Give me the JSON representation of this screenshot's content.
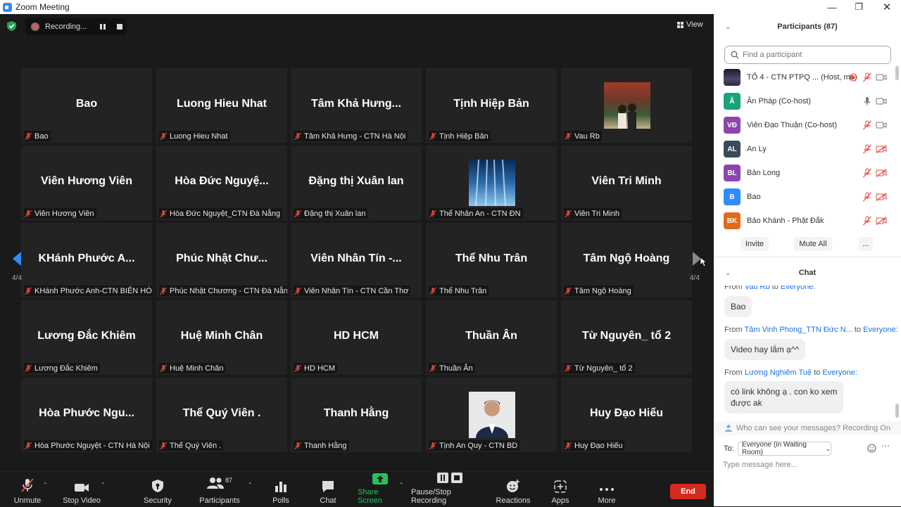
{
  "window": {
    "title": "Zoom Meeting"
  },
  "top": {
    "recording_label": "Recording...",
    "view_label": "View"
  },
  "pagination": {
    "left": "4/4",
    "right": "4/4"
  },
  "tiles": [
    {
      "big": "Bao",
      "label": "Bao",
      "muted": true
    },
    {
      "big": "Luong Hieu Nhat",
      "label": "Luong Hieu Nhat",
      "muted": true
    },
    {
      "big": "Tâm Khả Hưng...",
      "label": "Tâm Khả Hưng - CTN Hà Nội",
      "muted": true
    },
    {
      "big": "Tịnh Hiệp Bản",
      "label": "Tịnh Hiệp Bản",
      "muted": true
    },
    {
      "big": "",
      "label": "Vau Rb",
      "muted": true,
      "image": "photo-two-women"
    },
    {
      "big": "Viên Hương Viên",
      "label": "Viên Hương Viên",
      "muted": true
    },
    {
      "big": "Hòa Đức Nguyệ...",
      "label": "Hòa Đức Nguyệt_CTN Đà Nẵng",
      "muted": true
    },
    {
      "big": "Đặng thị Xuân lan",
      "label": "Đặng thị Xuân lan",
      "muted": true
    },
    {
      "big": "",
      "label": "Thể Nhân An - CTN ĐN",
      "muted": true,
      "image": "photo-blue-forest"
    },
    {
      "big": "Viên Tri Minh",
      "label": "Viên Tri Minh",
      "muted": true
    },
    {
      "big": "KHánh Phước A...",
      "label": "KHánh Phước Anh-CTN BIÊN HÒA",
      "muted": true
    },
    {
      "big": "Phúc Nhật Chư...",
      "label": "Phúc Nhật Chương - CTN Đà Nẵng",
      "muted": true
    },
    {
      "big": "Viên Nhân Tín -...",
      "label": "Viên Nhân Tín - CTN Cần Thơ",
      "muted": true
    },
    {
      "big": "Thể Nhu Trân",
      "label": "Thể Nhu Trân",
      "muted": true
    },
    {
      "big": "Tâm Ngộ Hoàng",
      "label": "Tâm Ngộ Hoàng",
      "muted": true
    },
    {
      "big": "Lương Đắc Khiêm",
      "label": "Lương Đắc Khiêm",
      "muted": true
    },
    {
      "big": "Huệ Minh Chân",
      "label": "Huệ Minh Chân",
      "muted": true
    },
    {
      "big": "HD HCM",
      "label": "HD HCM",
      "muted": true
    },
    {
      "big": "Thuần Ân",
      "label": "Thuần Ân",
      "muted": true
    },
    {
      "big": "Từ Nguyên_ tổ 2",
      "label": "Từ Nguyên_ tổ 2",
      "muted": true
    },
    {
      "big": "Hòa Phước Ngu...",
      "label": "Hòa Phước Nguyệt - CTN Hà Nội",
      "muted": true
    },
    {
      "big": "Thể Quý Viên .",
      "label": "Thể Quý Viên .",
      "muted": true
    },
    {
      "big": "Thanh Hằng",
      "label": "Thanh Hằng",
      "muted": true
    },
    {
      "big": "",
      "label": "Tịnh An Quy - CTN BD",
      "muted": true,
      "image": "photo-man-portrait"
    },
    {
      "big": "Huy Đạo Hiếu",
      "label": "Huy Đạo Hiếu",
      "muted": true
    }
  ],
  "toolbar": {
    "unmute": "Unmute",
    "stop_video": "Stop Video",
    "security": "Security",
    "participants": "Participants",
    "participants_count": "87",
    "polls": "Polls",
    "chat": "Chat",
    "share_screen": "Share Screen",
    "pause_stop_recording": "Pause/Stop Recording",
    "reactions": "Reactions",
    "apps": "Apps",
    "more": "More",
    "end": "End"
  },
  "participants_panel": {
    "title": "Participants (87)",
    "search_placeholder": "Find a participant",
    "list": [
      {
        "initials": "",
        "name": "TỔ 4 - CTN PTPQ ... (Host, me)",
        "color": "#2a2a3a",
        "mic": "off",
        "video": "on"
      },
      {
        "initials": "Â",
        "name": "Ân Pháp (Co-host)",
        "color": "#1aa37a",
        "mic": "on",
        "video": "on"
      },
      {
        "initials": "VĐ",
        "name": "Viên Đạo Thuận (Co-host)",
        "color": "#8e44ad",
        "mic": "off",
        "video": "on"
      },
      {
        "initials": "AL",
        "name": "An Ly",
        "color": "#3a4a5c",
        "mic": "off",
        "video": "off"
      },
      {
        "initials": "BL",
        "name": "Bản Long",
        "color": "#8e44ad",
        "mic": "off",
        "video": "off"
      },
      {
        "initials": "B",
        "name": "Bao",
        "color": "#2d8cff",
        "mic": "off",
        "video": "off"
      },
      {
        "initials": "BK",
        "name": "Bảo Khánh - Phật Đắk",
        "color": "#e06c1a",
        "mic": "off",
        "video": "off"
      }
    ],
    "invite": "Invite",
    "mute_all": "Mute All",
    "more": "..."
  },
  "chat_panel": {
    "title": "Chat",
    "messages": [
      {
        "from_prefix": "From",
        "from": "Vau Rb",
        "to_word": "to",
        "to": "Everyone:",
        "text": "Bao"
      },
      {
        "from_prefix": "From",
        "from": "Tâm Vinh Phong_TTN Đức N...",
        "to_word": "to",
        "to": "Everyone:",
        "text": "Video hay lắm ạ^^"
      },
      {
        "from_prefix": "From",
        "from": "Lương Nghiêm Tuệ",
        "to_word": "to",
        "to": "Everyone:",
        "text_line1": "có link không ạ . con ko xem",
        "text_line2": "được ak"
      }
    ],
    "who_can_see": "Who can see your messages? Recording On",
    "to_label": "To:",
    "to_value": "Everyone (in Waiting Room)",
    "input_placeholder": "Type message here..."
  },
  "colors": {
    "accent": "#2d8cff",
    "end_button": "#d52b1e",
    "muted_red": "#e04a3c"
  }
}
